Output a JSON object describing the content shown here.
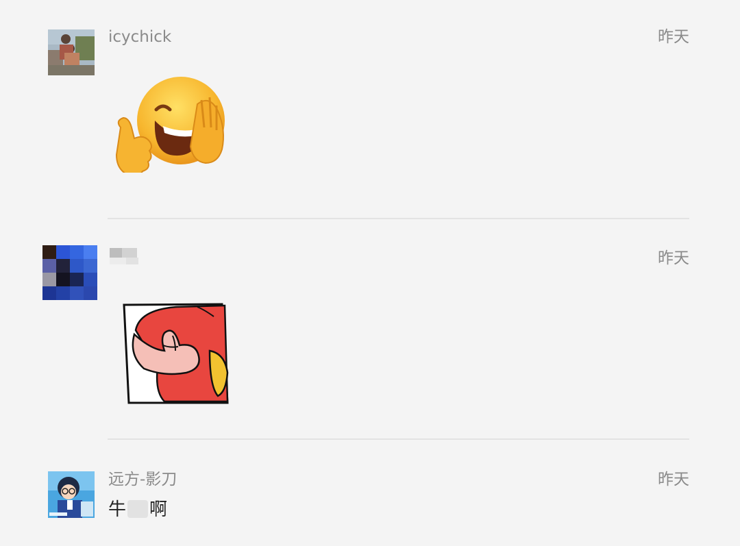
{
  "comments": [
    {
      "username": "icychick",
      "time": "昨天",
      "sticker": "facepalm-laugh-thumbs-up-emoji"
    },
    {
      "username": "",
      "time": "昨天",
      "sticker": "red-shirt-thumbs-up-sticker"
    },
    {
      "username": "远方-影刀",
      "time": "昨天",
      "text_before": "牛",
      "text_after": "啊"
    }
  ],
  "colors": {
    "background": "#f4f4f4",
    "meta_text": "#8a8a8a",
    "divider": "#e3e3e3"
  }
}
